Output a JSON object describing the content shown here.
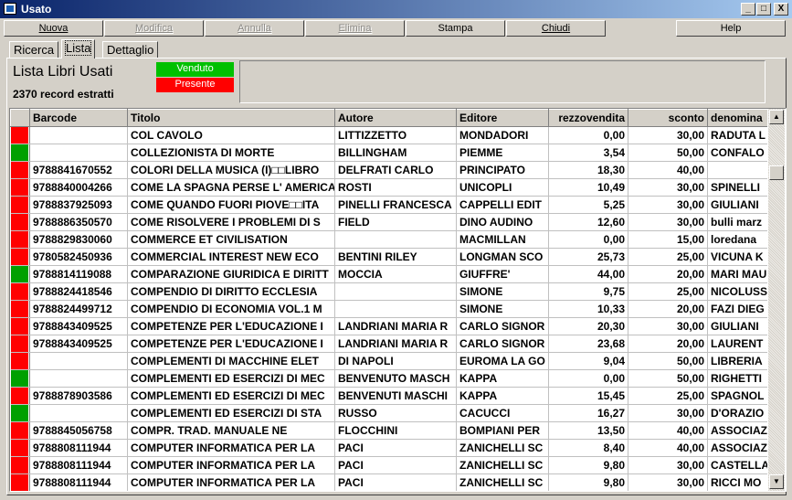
{
  "window": {
    "title": "Usato",
    "controls": {
      "minimize": "_",
      "maximize": "□",
      "close": "X"
    }
  },
  "toolbar": {
    "buttons": [
      {
        "label": "Nuova",
        "enabled": true
      },
      {
        "label": "Modifica",
        "enabled": false
      },
      {
        "label": "Annulla",
        "enabled": false
      },
      {
        "label": "Elimina",
        "enabled": false
      },
      {
        "label": "Stampa",
        "enabled": true
      },
      {
        "label": "Chiudi",
        "enabled": true
      },
      {
        "label": "Help",
        "enabled": true
      }
    ]
  },
  "tabs": [
    {
      "label": "Ricerca",
      "active": false
    },
    {
      "label": "Lista",
      "active": true
    },
    {
      "label": "Dettaglio",
      "active": false
    }
  ],
  "header": {
    "title": "Lista Libri Usati",
    "record_count": "2370 record estratti",
    "legend": {
      "sold": "Venduto",
      "present": "Presente"
    }
  },
  "colors": {
    "sold": "#00a000",
    "present": "#ff0000",
    "sold_legend": "#00c000"
  },
  "grid": {
    "columns": [
      "",
      "Barcode",
      "Titolo",
      "Autore",
      "Editore",
      "rezzovendita",
      "sconto",
      "denomina"
    ],
    "rows": [
      {
        "status": "present",
        "barcode": "",
        "titolo": "COL CAVOLO",
        "autore": "LITTIZZETTO",
        "editore": "MONDADORI",
        "prezzo": "0,00",
        "sconto": "30,00",
        "denominazione": "RADUTA L"
      },
      {
        "status": "sold",
        "barcode": "",
        "titolo": "COLLEZIONISTA DI MORTE",
        "autore": "BILLINGHAM",
        "editore": "PIEMME",
        "prezzo": "3,54",
        "sconto": "50,00",
        "denominazione": "CONFALO"
      },
      {
        "status": "present",
        "barcode": "9788841670552",
        "titolo": "COLORI DELLA MUSICA (I)□□LIBRO",
        "autore": "DELFRATI CARLO",
        "editore": "PRINCIPATO",
        "prezzo": "18,30",
        "sconto": "40,00",
        "denominazione": ""
      },
      {
        "status": "present",
        "barcode": "9788840004266",
        "titolo": "COME LA SPAGNA PERSE L' AMERICA",
        "autore": "ROSTI",
        "editore": "UNICOPLI",
        "prezzo": "10,49",
        "sconto": "30,00",
        "denominazione": "SPINELLI"
      },
      {
        "status": "present",
        "barcode": "9788837925093",
        "titolo": "COME QUANDO FUORI PIOVE□□ITA",
        "autore": "PINELLI FRANCESCA",
        "editore": "CAPPELLI EDIT",
        "prezzo": "5,25",
        "sconto": "30,00",
        "denominazione": "GIULIANI"
      },
      {
        "status": "present",
        "barcode": "9788886350570",
        "titolo": "COME RISOLVERE I PROBLEMI DI S",
        "autore": "FIELD",
        "editore": "DINO AUDINO",
        "prezzo": "12,60",
        "sconto": "30,00",
        "denominazione": "bulli marz"
      },
      {
        "status": "present",
        "barcode": "9788829830060",
        "titolo": "COMMERCE ET CIVILISATION",
        "autore": "",
        "editore": "MACMILLAN",
        "prezzo": "0,00",
        "sconto": "15,00",
        "denominazione": "loredana"
      },
      {
        "status": "present",
        "barcode": "9780582450936",
        "titolo": "COMMERCIAL INTEREST NEW ECO",
        "autore": "BENTINI RILEY",
        "editore": "LONGMAN SCO",
        "prezzo": "25,73",
        "sconto": "25,00",
        "denominazione": "VICUNA K"
      },
      {
        "status": "sold",
        "barcode": "9788814119088",
        "titolo": "COMPARAZIONE GIURIDICA E DIRITT",
        "autore": "MOCCIA",
        "editore": "GIUFFRE'",
        "prezzo": "44,00",
        "sconto": "20,00",
        "denominazione": "MARI MAU"
      },
      {
        "status": "present",
        "barcode": "9788824418546",
        "titolo": "COMPENDIO DI DIRITTO ECCLESIA",
        "autore": "",
        "editore": "SIMONE",
        "prezzo": "9,75",
        "sconto": "25,00",
        "denominazione": "NICOLUSS"
      },
      {
        "status": "present",
        "barcode": "9788824499712",
        "titolo": "COMPENDIO DI ECONOMIA VOL.1 M",
        "autore": "",
        "editore": "SIMONE",
        "prezzo": "10,33",
        "sconto": "20,00",
        "denominazione": "FAZI DIEG"
      },
      {
        "status": "present",
        "barcode": "9788843409525",
        "titolo": "COMPETENZE PER L'EDUCAZIONE I",
        "autore": "LANDRIANI MARIA R",
        "editore": "CARLO SIGNOR",
        "prezzo": "20,30",
        "sconto": "30,00",
        "denominazione": "GIULIANI"
      },
      {
        "status": "present",
        "barcode": "9788843409525",
        "titolo": "COMPETENZE PER L'EDUCAZIONE I",
        "autore": "LANDRIANI MARIA R",
        "editore": "CARLO SIGNOR",
        "prezzo": "23,68",
        "sconto": "20,00",
        "denominazione": "LAURENT"
      },
      {
        "status": "present",
        "barcode": "",
        "titolo": "COMPLEMENTI DI MACCHINE ELET",
        "autore": "DI NAPOLI",
        "editore": "EUROMA LA GO",
        "prezzo": "9,04",
        "sconto": "50,00",
        "denominazione": "LIBRERIA"
      },
      {
        "status": "sold",
        "barcode": "",
        "titolo": "COMPLEMENTI ED ESERCIZI DI MEC",
        "autore": "BENVENUTO MASCH",
        "editore": "KAPPA",
        "prezzo": "0,00",
        "sconto": "50,00",
        "denominazione": "RIGHETTI"
      },
      {
        "status": "present",
        "barcode": "9788878903586",
        "titolo": "COMPLEMENTI ED ESERCIZI DI MEC",
        "autore": "BENVENUTI MASCHI",
        "editore": "KAPPA",
        "prezzo": "15,45",
        "sconto": "25,00",
        "denominazione": "SPAGNOL"
      },
      {
        "status": "sold",
        "barcode": "",
        "titolo": "COMPLEMENTI ED ESERCIZI DI STA",
        "autore": "RUSSO",
        "editore": "CACUCCI",
        "prezzo": "16,27",
        "sconto": "30,00",
        "denominazione": "D'ORAZIO"
      },
      {
        "status": "present",
        "barcode": "9788845056758",
        "titolo": "COMPR. TRAD. MANUALE NE",
        "autore": "FLOCCHINI",
        "editore": "BOMPIANI PER",
        "prezzo": "13,50",
        "sconto": "40,00",
        "denominazione": "ASSOCIAZ"
      },
      {
        "status": "present",
        "barcode": "9788808111944",
        "titolo": "COMPUTER INFORMATICA PER LA",
        "autore": "PACI",
        "editore": "ZANICHELLI SC",
        "prezzo": "8,40",
        "sconto": "40,00",
        "denominazione": "ASSOCIAZ"
      },
      {
        "status": "present",
        "barcode": "9788808111944",
        "titolo": "COMPUTER INFORMATICA PER LA",
        "autore": "PACI",
        "editore": "ZANICHELLI SC",
        "prezzo": "9,80",
        "sconto": "30,00",
        "denominazione": "CASTELLA"
      },
      {
        "status": "present",
        "barcode": "9788808111944",
        "titolo": "COMPUTER INFORMATICA PER LA",
        "autore": "PACI",
        "editore": "ZANICHELLI SC",
        "prezzo": "9,80",
        "sconto": "30,00",
        "denominazione": "RICCI MO"
      }
    ]
  },
  "scrollbar": {
    "up": "▲",
    "down": "▼"
  }
}
